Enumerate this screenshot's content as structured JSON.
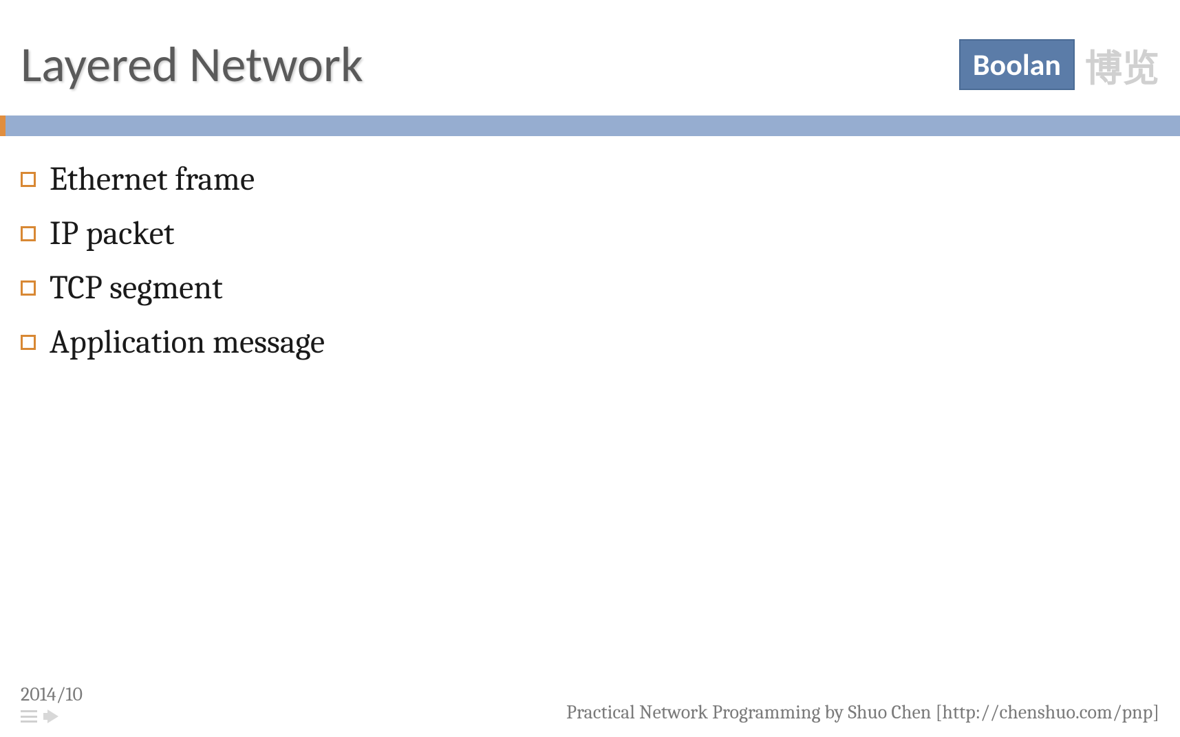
{
  "header": {
    "title": "Layered Network",
    "logo_primary": "Boolan",
    "logo_secondary": "博览"
  },
  "bullets": {
    "items": [
      "Ethernet frame",
      "IP packet",
      "TCP segment",
      "Application message"
    ]
  },
  "footer": {
    "date": "2014/10",
    "attribution": "Practical Network Programming by Shuo Chen [http://chenshuo.com/pnp]"
  }
}
